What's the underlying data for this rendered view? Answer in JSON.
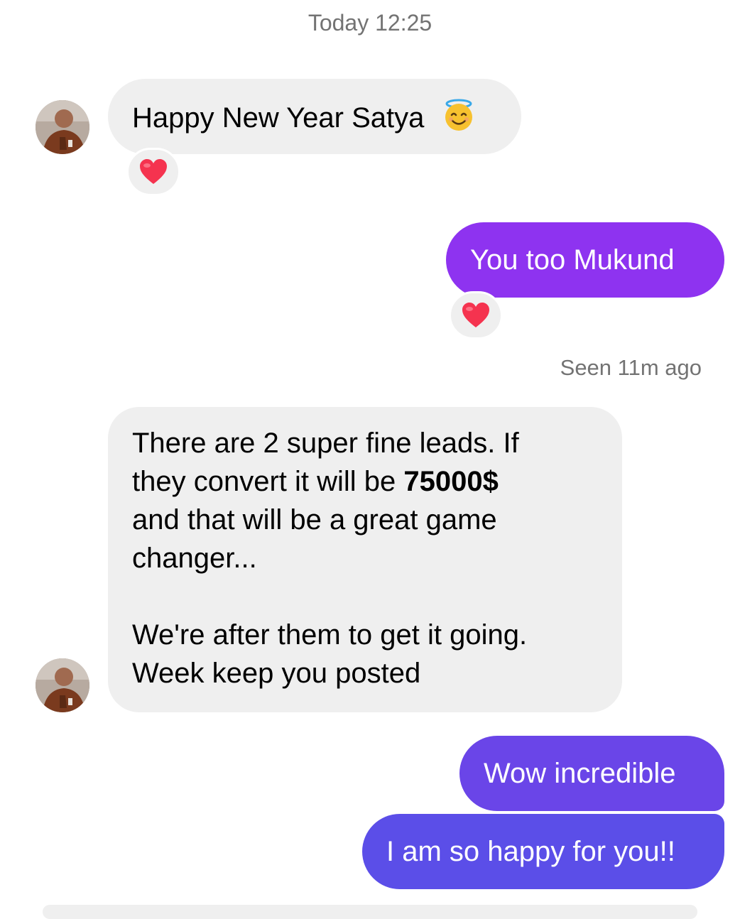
{
  "timestamp": "Today 12:25",
  "messages": [
    {
      "sender": "Mukund",
      "direction": "incoming",
      "text": "Happy New Year Satya",
      "emoji": "smiling-face-with-halo",
      "reaction": "heart"
    },
    {
      "sender": "Satya",
      "direction": "outgoing",
      "text": "You too Mukund",
      "reaction": "heart"
    },
    {
      "sender": "Mukund",
      "direction": "incoming",
      "lines": [
        "There are 2 super fine leads. If",
        "they convert it will be ",
        "75000$",
        "and that will be a great game",
        "changer...",
        "We're after them to get it going.",
        "Week keep you posted"
      ]
    },
    {
      "sender": "Satya",
      "direction": "outgoing",
      "text": "Wow incredible"
    },
    {
      "sender": "Satya",
      "direction": "outgoing",
      "text": "I am so happy for you!!"
    }
  ],
  "seen_status": "Seen 11m ago",
  "colors": {
    "incoming_bubble": "#efefef",
    "outgoing_purple": "#8e33f0",
    "outgoing_violet": "#6a45e8",
    "outgoing_blue": "#5b4ee8",
    "heart": "#f5334f",
    "meta_text": "#737373"
  }
}
